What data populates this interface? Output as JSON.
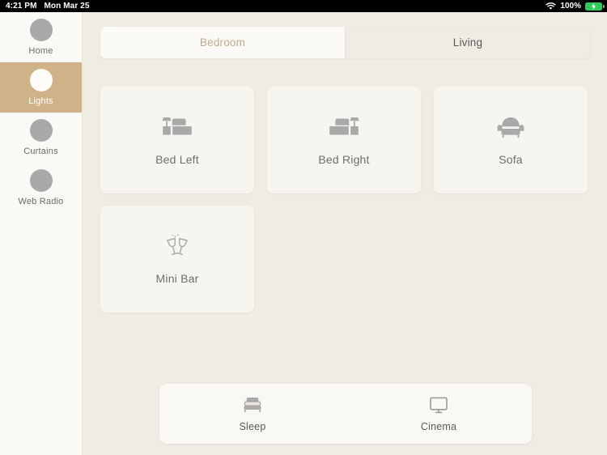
{
  "statusbar": {
    "time": "4:21 PM",
    "date": "Mon Mar 25",
    "wifi_icon": "wifi-icon",
    "battery_percent": "100%",
    "battery_icon": "battery-charging-icon"
  },
  "sidebar": {
    "items": [
      {
        "label": "Home",
        "icon": "home-circle-icon",
        "active": false
      },
      {
        "label": "Lights",
        "icon": "lights-circle-icon",
        "active": true
      },
      {
        "label": "Curtains",
        "icon": "curtains-circle-icon",
        "active": false
      },
      {
        "label": "Web Radio",
        "icon": "web-radio-circle-icon",
        "active": false
      }
    ]
  },
  "tabs": [
    {
      "label": "Bedroom",
      "active": true
    },
    {
      "label": "Living",
      "active": false
    }
  ],
  "cards": [
    {
      "label": "Bed Left",
      "icon": "bed-left-icon"
    },
    {
      "label": "Bed Right",
      "icon": "bed-right-icon"
    },
    {
      "label": "Sofa",
      "icon": "sofa-icon"
    },
    {
      "label": "Mini Bar",
      "icon": "mini-bar-icon"
    }
  ],
  "scenes": [
    {
      "label": "Sleep",
      "icon": "bed-icon"
    },
    {
      "label": "Cinema",
      "icon": "monitor-icon"
    }
  ],
  "colors": {
    "accent": "#cdb387",
    "tab_active_text": "#c0ab87",
    "page_bg": "#efece4",
    "card_bg": "#f7f5f0",
    "sidebar_bg": "#faf9f6",
    "icon_gray": "#a9a9a9",
    "battery_green": "#34c759"
  }
}
